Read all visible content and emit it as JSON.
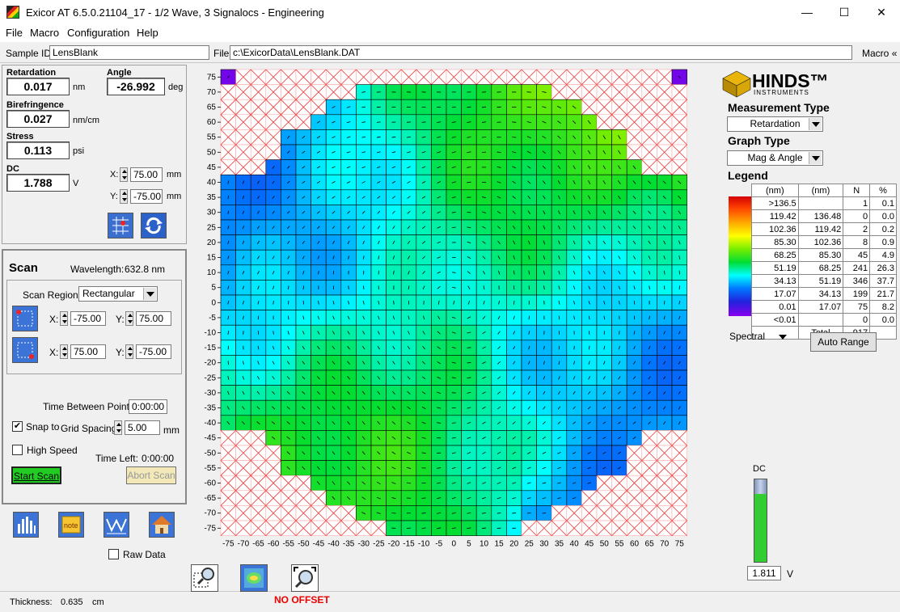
{
  "window": {
    "title": "Exicor AT 6.5.0.21104_17 - 1/2 Wave, 3 Signalocs - Engineering",
    "minimize": "—",
    "maximize": "☐",
    "close": "✕"
  },
  "menu": [
    "File",
    "Macro",
    "Configuration",
    "Help"
  ],
  "info": {
    "sample_label": "Sample ID:",
    "sample_value": "LensBlank",
    "file_label": "File:",
    "file_value": "c:\\ExicorData\\LensBlank.DAT",
    "macro_label": "Macro",
    "macro_chevron": "«"
  },
  "readings": {
    "retardation_label": "Retardation",
    "retardation_value": "0.017",
    "retardation_unit": "nm",
    "angle_label": "Angle",
    "angle_value": "-26.992",
    "angle_unit": "deg",
    "birefringence_label": "Birefringence",
    "birefringence_value": "0.027",
    "birefringence_unit": "nm/cm",
    "stress_label": "Stress",
    "stress_value": "0.113",
    "stress_unit": "psi",
    "dc_label": "DC",
    "dc_value": "1.788",
    "dc_unit": "V",
    "x_label": "X:",
    "x_value": "75.00",
    "x_unit": "mm",
    "y_label": "Y:",
    "y_value": "-75.00",
    "y_unit": "mm"
  },
  "scan": {
    "title": "Scan",
    "wavelength_label": "Wavelength:",
    "wavelength_value": "632.8 nm",
    "region_label": "Scan Region:",
    "region_value": "Rectangular",
    "x1_label": "X:",
    "x1_value": "-75.00",
    "y1_label": "Y:",
    "y1_value": "75.00",
    "x2_label": "X:",
    "x2_value": "75.00",
    "y2_label": "Y:",
    "y2_value": "-75.00",
    "time_between_label": "Time Between Points:",
    "time_between_value": "0:00:00",
    "snap_label": "Snap to",
    "snap_checked": "✔",
    "grid_spacing_label": "Grid Spacing:",
    "grid_spacing_value": "5.00",
    "grid_spacing_unit": "mm",
    "high_speed_label": "High Speed",
    "time_left_label": "Time Left:",
    "time_left_value": "0:00:00",
    "start_label": "Start Scan",
    "abort_label": "Abort Scan"
  },
  "raw_data_label": "Raw Data",
  "thickness_label": "Thickness:",
  "thickness_value": "0.635",
  "thickness_unit": "cm",
  "no_offset_label": "NO OFFSET",
  "right": {
    "logo_text": "HINDS™",
    "logo_sub": "INSTRUMENTS",
    "measurement_type_label": "Measurement Type",
    "measurement_type_value": "Retardation",
    "graph_type_label": "Graph Type",
    "graph_type_value": "Mag & Angle",
    "legend_label": "Legend",
    "legend_headers": [
      "(nm)",
      "(nm)",
      "N",
      "%"
    ],
    "legend_rows": [
      [
        ">136.5",
        "",
        "1",
        "0.1"
      ],
      [
        "119.42",
        "136.48",
        "0",
        "0.0"
      ],
      [
        "102.36",
        "119.42",
        "2",
        "0.2"
      ],
      [
        "85.30",
        "102.36",
        "8",
        "0.9"
      ],
      [
        "68.25",
        "85.30",
        "45",
        "4.9"
      ],
      [
        "51.19",
        "68.25",
        "241",
        "26.3"
      ],
      [
        "34.13",
        "51.19",
        "346",
        "37.7"
      ],
      [
        "17.07",
        "34.13",
        "199",
        "21.7"
      ],
      [
        "0.01",
        "17.07",
        "75",
        "8.2"
      ],
      [
        "<0.01",
        "",
        "0",
        "0.0"
      ]
    ],
    "legend_total_label": "Total",
    "legend_total_value": "917",
    "spectral_label": "Spectral",
    "auto_range_label": "Auto Range",
    "dc_label": "DC",
    "dc_value": "1.811",
    "dc_unit": "V",
    "dc_level": 0.82
  },
  "colors": {
    "accent_green": "#22cc22",
    "no_offset_red": "#e00000"
  },
  "chart_data": {
    "type": "heatmap",
    "x_ticks": [
      -75,
      -70,
      -65,
      -60,
      -55,
      -50,
      -45,
      -40,
      -35,
      -30,
      -25,
      -20,
      -15,
      -10,
      -5,
      0,
      5,
      10,
      15,
      20,
      25,
      30,
      35,
      40,
      45,
      50,
      55,
      60,
      65,
      70,
      75
    ],
    "y_ticks": [
      75,
      70,
      65,
      60,
      55,
      50,
      45,
      40,
      35,
      30,
      25,
      20,
      15,
      10,
      5,
      0,
      -5,
      -10,
      -15,
      -20,
      -25,
      -30,
      -35,
      -40,
      -45,
      -50,
      -55,
      -60,
      -65,
      -70,
      -75
    ],
    "value_range_nm": [
      0,
      136.5
    ],
    "colormap": "Spectral",
    "grid_spacing_mm": 5
  }
}
